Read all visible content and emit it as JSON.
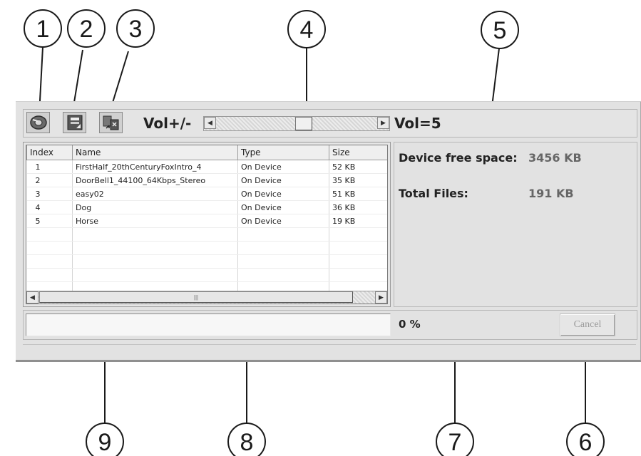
{
  "callouts": [
    "1",
    "2",
    "3",
    "4",
    "5",
    "6",
    "7",
    "8",
    "9"
  ],
  "toolbar": {
    "icons": [
      "disc-icon",
      "save-icon",
      "transfer-icon"
    ],
    "vol_label": "Vol+/-",
    "vol_value_label": "Vol=5",
    "volume_level": 0.55
  },
  "table": {
    "columns": [
      "Index",
      "Name",
      "Type",
      "Size"
    ],
    "rows": [
      [
        "1",
        "FirstHalf_20thCenturyFoxIntro_4",
        "On Device",
        "52 KB"
      ],
      [
        "2",
        "DoorBell1_44100_64Kbps_Stereo",
        "On Device",
        "35 KB"
      ],
      [
        "3",
        "easy02",
        "On Device",
        "51 KB"
      ],
      [
        "4",
        "Dog",
        "On Device",
        "36 KB"
      ],
      [
        "5",
        "Horse",
        "On Device",
        "19 KB"
      ]
    ]
  },
  "info": {
    "free_space_label": "Device free space:",
    "free_space_value": "3456 KB",
    "total_files_label": "Total Files:",
    "total_files_value": "191 KB"
  },
  "progress": {
    "percent": 0,
    "percent_label": "0 %"
  },
  "buttons": {
    "cancel": "Cancel"
  }
}
